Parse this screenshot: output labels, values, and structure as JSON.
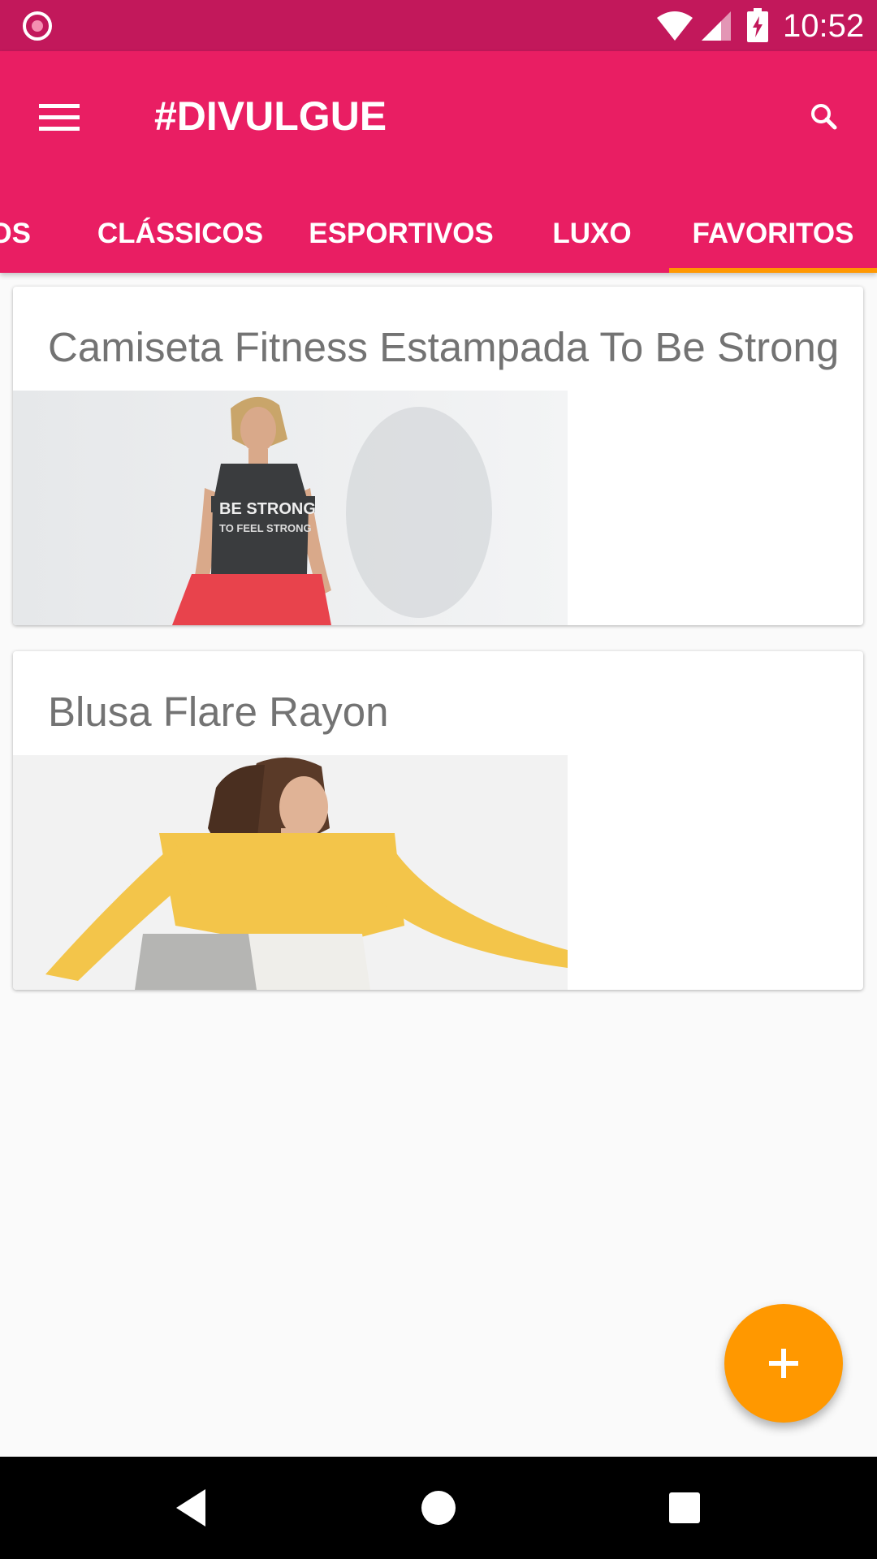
{
  "status_bar": {
    "time": "10:52",
    "icons": [
      "notification-icon",
      "wifi-icon",
      "cellular-signal-icon",
      "battery-charging-icon"
    ]
  },
  "app_bar": {
    "title": "#DIVULGUE",
    "menu_icon": "hamburger-menu-icon",
    "search_icon": "search-icon"
  },
  "tabs": [
    {
      "label": "DOS",
      "selected": false
    },
    {
      "label": "CLÁSSICOS",
      "selected": false
    },
    {
      "label": "ESPORTIVOS",
      "selected": false
    },
    {
      "label": "LUXO",
      "selected": false
    },
    {
      "label": "FAVORITOS",
      "selected": true
    }
  ],
  "cards": [
    {
      "title": "Camiseta Fitness Estampada To Be Strong",
      "image_text": "TO BE STRONG\nTO FEEL STRONG"
    },
    {
      "title": "Blusa Flare Rayon"
    }
  ],
  "fab": {
    "icon": "plus-icon"
  },
  "nav_bar": {
    "icons": [
      "back-icon",
      "home-icon",
      "recents-icon"
    ]
  },
  "colors": {
    "status_bar": "#c2185b",
    "primary": "#e91e63",
    "accent": "#ff9800",
    "card_title": "#737373"
  }
}
